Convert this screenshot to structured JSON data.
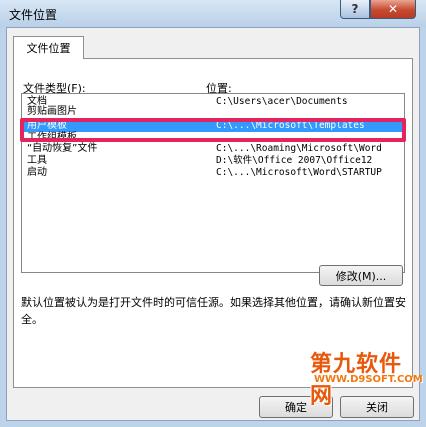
{
  "window": {
    "title": "文件位置",
    "help": "?",
    "close": "✕"
  },
  "tab": {
    "label": "文件位置"
  },
  "headers": {
    "type": "文件类型(F):",
    "location": "位置:"
  },
  "rows": [
    {
      "type": "文档",
      "location": "C:\\Users\\acer\\Documents"
    },
    {
      "type": "剪贴画图片",
      "location": ""
    },
    {
      "type": "用户模板",
      "location": "C:\\...\\Microsoft\\Templates"
    },
    {
      "type": "工作组模板",
      "location": ""
    },
    {
      "type": "“自动恢复”文件",
      "location": "C:\\...\\Roaming\\Microsoft\\Word"
    },
    {
      "type": "工具",
      "location": "D:\\软件\\Office 2007\\Office12"
    },
    {
      "type": "启动",
      "location": "C:\\...\\Microsoft\\Word\\STARTUP"
    }
  ],
  "buttons": {
    "modify": "修改(M)...",
    "ok": "确定",
    "cancel": "关闭"
  },
  "note": "默认位置被认为是打开文件时的可信任源。如果选择其他位置，请确认新位置安全。",
  "watermark": {
    "top": "第九软件网",
    "bottom": "WWW.D9SOFT.COM"
  },
  "colors": {
    "selection": "#3399ff",
    "highlight_box": "#e4245f"
  }
}
